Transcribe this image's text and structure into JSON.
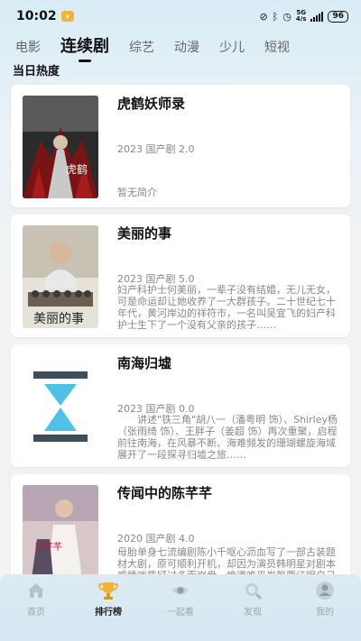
{
  "status": {
    "time": "10:02",
    "net": "5G",
    "net_speed": "4/s",
    "battery": "96"
  },
  "tabs": [
    {
      "label": "电影",
      "active": false
    },
    {
      "label": "连续剧",
      "active": true
    },
    {
      "label": "综艺",
      "active": false
    },
    {
      "label": "动漫",
      "active": false
    },
    {
      "label": "少儿",
      "active": false
    },
    {
      "label": "短视",
      "active": false
    }
  ],
  "section_title": "当日热度",
  "cards": [
    {
      "title": "虎鹤妖师录",
      "meta": "2023 国产剧 2.0",
      "desc": "暂无简介",
      "poster_text": "虎鹤"
    },
    {
      "title": "美丽的事",
      "meta": "2023 国产剧 5.0",
      "desc": "妇产科护士何美丽，一辈子没有结婚，无儿无女，可是命运却让她收养了一大群孩子。二十世纪七十年代，黄河岸边的祥符市，一名叫吴宜飞的妇产科护士生下了一个没有父亲的孩子……",
      "poster_text": "美丽的事"
    },
    {
      "title": "南海归墟",
      "meta": "2023 国产剧 0.0",
      "desc": "　　讲述\"铁三角\"胡八一（潘粤明 饰）、Shirley杨（张雨绮 饰）、王胖子（姜超 饰）再次重聚，启程前往南海，在风暴不断、海难频发的珊瑚螺旋海域展开了一段探寻归墟之旅……",
      "poster_text": ""
    },
    {
      "title": "传闻中的陈芊芊",
      "meta": "2020 国产剧 4.0",
      "desc": "母胎单身七流编剧陈小千呕心沥血写了一部古装题材大剧，原可顺利开机，却因为演员韩明星对剧本感情戏质疑过多而崩盘。愤懑难平发誓要证明自己能力的她，意外卡进了自己的……",
      "poster_text": "陈芊芊"
    }
  ],
  "bottom_nav": [
    {
      "label": "首页",
      "icon": "home-icon",
      "active": false
    },
    {
      "label": "排行榜",
      "icon": "trophy-icon",
      "active": true
    },
    {
      "label": "一起看",
      "icon": "eye-icon",
      "active": false
    },
    {
      "label": "发现",
      "icon": "discover-icon",
      "active": false
    },
    {
      "label": "我的",
      "icon": "user-icon",
      "active": false
    }
  ],
  "colors": {
    "accent_dark": "#111111",
    "inactive_nav": "#9aa6ae",
    "hourglass": "#3d4d5c",
    "hourglass_sand": "#4fc1e9",
    "trophy": "#f2b33a"
  }
}
